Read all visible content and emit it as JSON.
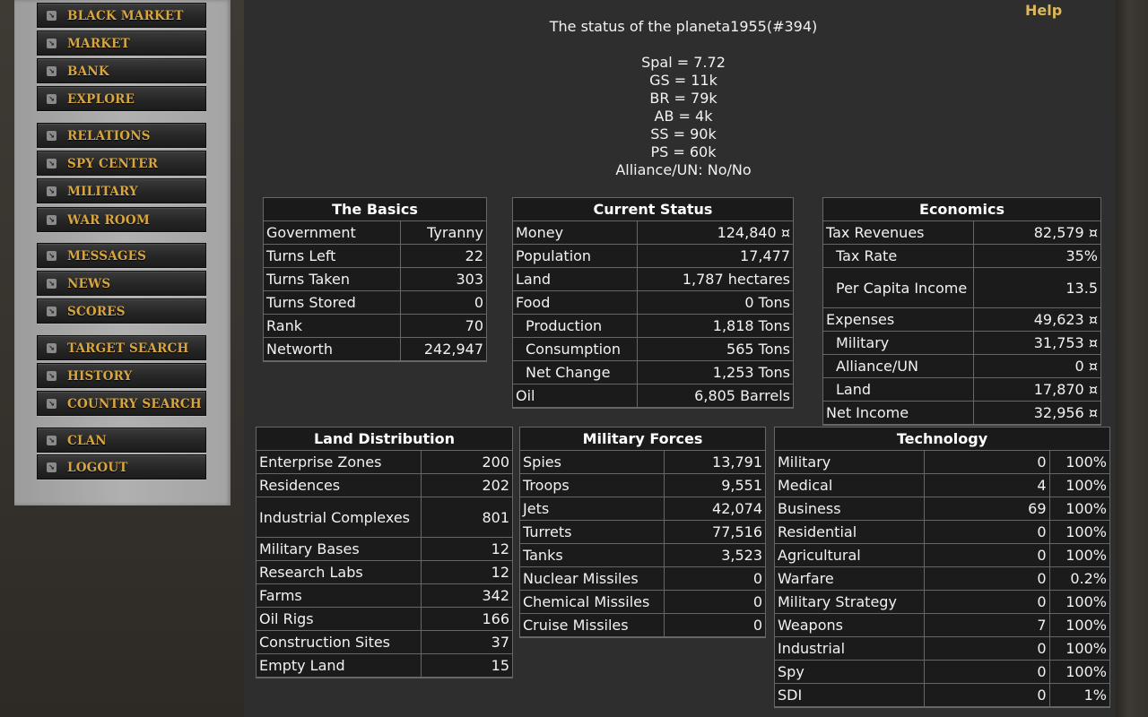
{
  "nav": {
    "items": [
      {
        "label": "BLACK MARKET"
      },
      {
        "label": "MARKET"
      },
      {
        "label": "BANK"
      },
      {
        "label": "EXPLORE"
      },
      {
        "label": "RELATIONS"
      },
      {
        "label": "SPY CENTER"
      },
      {
        "label": "MILITARY"
      },
      {
        "label": "WAR ROOM"
      },
      {
        "label": "MESSAGES"
      },
      {
        "label": "NEWS"
      },
      {
        "label": "SCORES"
      },
      {
        "label": "TARGET SEARCH"
      },
      {
        "label": "HISTORY"
      },
      {
        "label": "COUNTRY SEARCH"
      },
      {
        "label": "CLAN"
      },
      {
        "label": "LOGOUT"
      }
    ]
  },
  "help": "Help",
  "status": {
    "title": "The status of the planeta1955(#394)",
    "lines": [
      "Spal = 7.72",
      "GS = 11k",
      "BR = 79k",
      "AB = 4k",
      "SS = 90k",
      "PS = 60k",
      "Alliance/UN: No/No"
    ]
  },
  "basics": {
    "title": "The Basics",
    "rows": [
      {
        "label": "Government",
        "value": "Tyranny"
      },
      {
        "label": "Turns Left",
        "value": "22"
      },
      {
        "label": "Turns Taken",
        "value": "303"
      },
      {
        "label": "Turns Stored",
        "value": "0"
      },
      {
        "label": "Rank",
        "value": "70"
      },
      {
        "label": "Networth",
        "value": "242,947"
      }
    ]
  },
  "current_status": {
    "title": "Current Status",
    "rows": [
      {
        "label": "Money",
        "value": "124,840 ¤"
      },
      {
        "label": "Population",
        "value": "17,477"
      },
      {
        "label": "Land",
        "value": "1,787 hectares"
      },
      {
        "label": "Food",
        "value": "0 Tons"
      },
      {
        "label": "Production",
        "value": "1,818 Tons"
      },
      {
        "label": "Consumption",
        "value": "565 Tons"
      },
      {
        "label": "Net Change",
        "value": "1,253 Tons"
      },
      {
        "label": "Oil",
        "value": "6,805 Barrels"
      }
    ]
  },
  "economics": {
    "title": "Economics",
    "rows": [
      {
        "label": "Tax Revenues",
        "value": "82,579 ¤"
      },
      {
        "label": "Tax Rate",
        "value": "35%"
      },
      {
        "label": "Per Capita Income",
        "value": "13.5"
      },
      {
        "label": "Expenses",
        "value": "49,623 ¤"
      },
      {
        "label": "Military",
        "value": "31,753 ¤"
      },
      {
        "label": "Alliance/UN",
        "value": "0 ¤"
      },
      {
        "label": "Land",
        "value": "17,870 ¤"
      },
      {
        "label": "Net Income",
        "value": "32,956 ¤"
      }
    ]
  },
  "land": {
    "title": "Land Distribution",
    "rows": [
      {
        "label": "Enterprise Zones",
        "value": "200"
      },
      {
        "label": "Residences",
        "value": "202"
      },
      {
        "label": "Industrial Complexes",
        "value": "801"
      },
      {
        "label": "Military Bases",
        "value": "12"
      },
      {
        "label": "Research Labs",
        "value": "12"
      },
      {
        "label": "Farms",
        "value": "342"
      },
      {
        "label": "Oil Rigs",
        "value": "166"
      },
      {
        "label": "Construction Sites",
        "value": "37"
      },
      {
        "label": "Empty Land",
        "value": "15"
      }
    ]
  },
  "military": {
    "title": "Military Forces",
    "rows": [
      {
        "label": "Spies",
        "value": "13,791"
      },
      {
        "label": "Troops",
        "value": "9,551"
      },
      {
        "label": "Jets",
        "value": "42,074"
      },
      {
        "label": "Turrets",
        "value": "77,516"
      },
      {
        "label": "Tanks",
        "value": "3,523"
      },
      {
        "label": "Nuclear Missiles",
        "value": "0"
      },
      {
        "label": "Chemical Missiles",
        "value": "0"
      },
      {
        "label": "Cruise Missiles",
        "value": "0"
      }
    ]
  },
  "technology": {
    "title": "Technology",
    "rows": [
      {
        "label": "Military",
        "points": "0",
        "pct": "100%"
      },
      {
        "label": "Medical",
        "points": "4",
        "pct": "100%"
      },
      {
        "label": "Business",
        "points": "69",
        "pct": "100%"
      },
      {
        "label": "Residential",
        "points": "0",
        "pct": "100%"
      },
      {
        "label": "Agricultural",
        "points": "0",
        "pct": "100%"
      },
      {
        "label": "Warfare",
        "points": "0",
        "pct": "0.2%"
      },
      {
        "label": "Military Strategy",
        "points": "0",
        "pct": "100%"
      },
      {
        "label": "Weapons",
        "points": "7",
        "pct": "100%"
      },
      {
        "label": "Industrial",
        "points": "0",
        "pct": "100%"
      },
      {
        "label": "Spy",
        "points": "0",
        "pct": "100%"
      },
      {
        "label": "SDI",
        "points": "0",
        "pct": "1%"
      }
    ]
  }
}
